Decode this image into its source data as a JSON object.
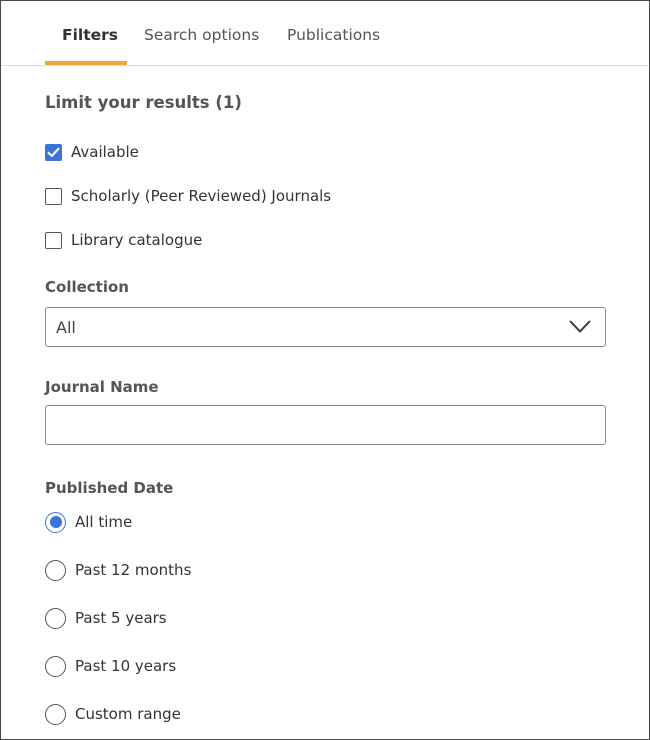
{
  "tabs": [
    {
      "label": "Filters",
      "active": true
    },
    {
      "label": "Search options",
      "active": false
    },
    {
      "label": "Publications",
      "active": false
    }
  ],
  "limit_section": {
    "heading": "Limit your results (1)",
    "options": [
      {
        "label": "Available",
        "checked": true
      },
      {
        "label": "Scholarly (Peer Reviewed) Journals",
        "checked": false
      },
      {
        "label": "Library catalogue",
        "checked": false
      }
    ]
  },
  "collection": {
    "label": "Collection",
    "selected": "All",
    "icon": "chevron-down-icon"
  },
  "journal_name": {
    "label": "Journal Name",
    "value": "",
    "placeholder": ""
  },
  "published_date": {
    "label": "Published Date",
    "options": [
      {
        "label": "All time",
        "checked": true
      },
      {
        "label": "Past 12 months",
        "checked": false
      },
      {
        "label": "Past 5 years",
        "checked": false
      },
      {
        "label": "Past 10 years",
        "checked": false
      },
      {
        "label": "Custom range",
        "checked": false
      }
    ]
  },
  "colors": {
    "accent": "#3b74d6",
    "tab_underline": "#f0a92e",
    "border": "#8a8a8a"
  }
}
